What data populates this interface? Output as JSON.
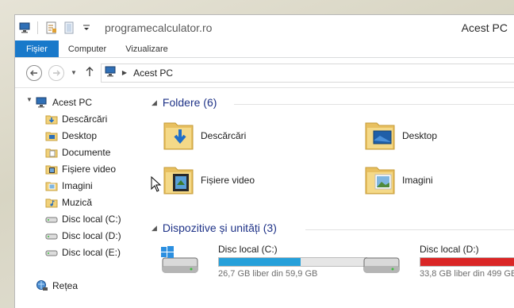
{
  "titlebar": {
    "url": "programecalculator.ro",
    "title": "Acest PC"
  },
  "ribbon": {
    "tabs": [
      {
        "label": "Fișier",
        "active": true
      },
      {
        "label": "Computer",
        "active": false
      },
      {
        "label": "Vizualizare",
        "active": false
      }
    ]
  },
  "address": {
    "path": "Acest PC"
  },
  "navpane": {
    "root": "Acest PC",
    "items": [
      {
        "label": "Descărcări",
        "icon": "downloads-folder-icon"
      },
      {
        "label": "Desktop",
        "icon": "desktop-folder-icon"
      },
      {
        "label": "Documente",
        "icon": "documents-folder-icon"
      },
      {
        "label": "Fișiere video",
        "icon": "videos-folder-icon"
      },
      {
        "label": "Imagini",
        "icon": "pictures-folder-icon"
      },
      {
        "label": "Muzică",
        "icon": "music-folder-icon"
      },
      {
        "label": "Disc local (C:)",
        "icon": "drive-icon"
      },
      {
        "label": "Disc local (D:)",
        "icon": "drive-icon"
      },
      {
        "label": "Disc local (E:)",
        "icon": "drive-icon"
      }
    ],
    "network": "Rețea"
  },
  "content": {
    "folders_header": "Foldere (6)",
    "folders": [
      {
        "label": "Descărcări",
        "icon": "downloads-folder-icon"
      },
      {
        "label": "Desktop",
        "icon": "desktop-folder-icon"
      },
      {
        "label": "Fișiere video",
        "icon": "videos-folder-icon"
      },
      {
        "label": "Imagini",
        "icon": "pictures-folder-icon"
      }
    ],
    "drives_header": "Dispozitive și unități (3)",
    "drives": [
      {
        "name": "Disc local (C:)",
        "free_text": "26,7 GB liber din 59,9 GB",
        "used_fraction": 0.554,
        "bar_color": "#26a0da"
      },
      {
        "name": "Disc local (D:)",
        "free_text": "33,8 GB liber din 499 GB",
        "used_fraction": 0.932,
        "bar_color": "#da2626"
      }
    ]
  },
  "colors": {
    "accent": "#1979ca",
    "header_text": "#1e3287"
  }
}
